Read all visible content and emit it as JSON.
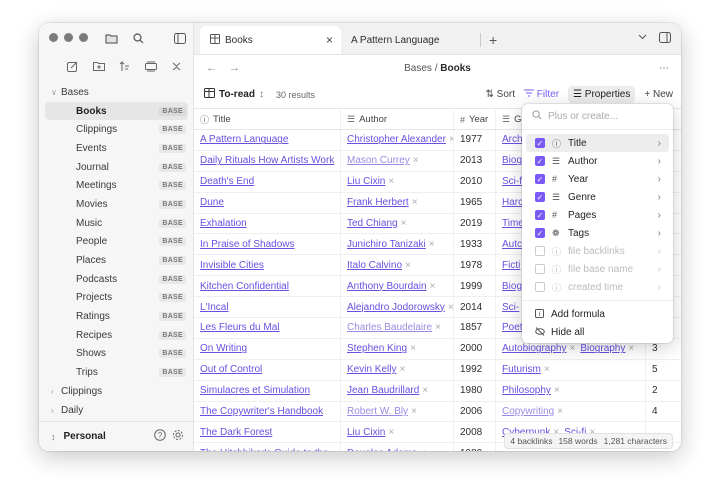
{
  "sidebar": {
    "top_icons": [
      "files-icon",
      "search-icon",
      "sidebar-toggle-icon"
    ],
    "action_icons": [
      "new-note-icon",
      "new-folder-icon",
      "sort-icon",
      "collapse-icon",
      "close-icon"
    ],
    "tree": [
      {
        "type": "folder",
        "label": "Bases",
        "open": true
      },
      {
        "type": "file",
        "label": "Books",
        "badge": "BASE",
        "active": true
      },
      {
        "type": "file",
        "label": "Clippings",
        "badge": "BASE"
      },
      {
        "type": "file",
        "label": "Events",
        "badge": "BASE"
      },
      {
        "type": "file",
        "label": "Journal",
        "badge": "BASE"
      },
      {
        "type": "file",
        "label": "Meetings",
        "badge": "BASE"
      },
      {
        "type": "file",
        "label": "Movies",
        "badge": "BASE"
      },
      {
        "type": "file",
        "label": "Music",
        "badge": "BASE"
      },
      {
        "type": "file",
        "label": "People",
        "badge": "BASE"
      },
      {
        "type": "file",
        "label": "Places",
        "badge": "BASE"
      },
      {
        "type": "file",
        "label": "Podcasts",
        "badge": "BASE"
      },
      {
        "type": "file",
        "label": "Projects",
        "badge": "BASE"
      },
      {
        "type": "file",
        "label": "Ratings",
        "badge": "BASE"
      },
      {
        "type": "file",
        "label": "Recipes",
        "badge": "BASE"
      },
      {
        "type": "file",
        "label": "Shows",
        "badge": "BASE"
      },
      {
        "type": "file",
        "label": "Trips",
        "badge": "BASE"
      },
      {
        "type": "folder",
        "label": "Clippings",
        "open": false
      },
      {
        "type": "folder",
        "label": "Daily",
        "open": false
      }
    ],
    "vault_name": "Personal"
  },
  "tabs": [
    {
      "label": "Books",
      "active": true
    },
    {
      "label": "A Pattern Language",
      "active": false
    }
  ],
  "breadcrumb": {
    "parent": "Bases",
    "sep": "/",
    "current": "Books"
  },
  "toolbar": {
    "view_name": "To-read",
    "results": "30 results",
    "sort_label": "Sort",
    "filter_label": "Filter",
    "properties_label": "Properties",
    "new_label": "New"
  },
  "table": {
    "headers": [
      "Title",
      "Author",
      "Year",
      "G"
    ],
    "rows": [
      {
        "title": "A Pattern Language",
        "author": "Christopher Alexander",
        "year": "1977",
        "genre": [
          "Arch"
        ],
        "extra": ""
      },
      {
        "title": "Daily Rituals How Artists Work",
        "author": "Mason Currey",
        "author_muted": true,
        "year": "2013",
        "genre": [
          "Biog"
        ],
        "extra": "2"
      },
      {
        "title": "Death's End",
        "author": "Liu Cixin",
        "year": "2010",
        "genre": [
          "Sci-f"
        ],
        "extra": "6"
      },
      {
        "title": "Dune",
        "author": "Frank Herbert",
        "year": "1965",
        "genre": [
          "Harc"
        ],
        "extra": ""
      },
      {
        "title": "Exhalation",
        "author": "Ted Chiang",
        "year": "2019",
        "genre": [
          "Time"
        ],
        "extra": ""
      },
      {
        "title": "In Praise of Shadows",
        "author": "Junichiro Tanizaki",
        "year": "1933",
        "genre": [
          "Autc"
        ],
        "extra": ""
      },
      {
        "title": "Invisible Cities",
        "author": "Italo Calvino",
        "year": "1978",
        "genre": [
          "Ficti"
        ],
        "extra": ""
      },
      {
        "title": "Kitchen Confidential",
        "author": "Anthony Bourdain",
        "year": "1999",
        "genre": [
          "Biog"
        ],
        "extra": "3"
      },
      {
        "title": "L'Incal",
        "author": "Alejandro Jodorowsky",
        "year": "2014",
        "genre": [
          "Sci-"
        ],
        "extra": "3"
      },
      {
        "title": "Les Fleurs du Mal",
        "author": "Charles Baudelaire",
        "author_muted": true,
        "year": "1857",
        "genre": [
          "Poet"
        ],
        "extra": ""
      },
      {
        "title": "On Writing",
        "author": "Stephen King",
        "year": "2000",
        "genre": [
          "Autobiography",
          "Biography"
        ],
        "extra": "3"
      },
      {
        "title": "Out of Control",
        "author": "Kevin Kelly",
        "year": "1992",
        "genre": [
          "Futurism"
        ],
        "extra": "5"
      },
      {
        "title": "Simulacres et Simulation",
        "author": "Jean Baudrillard",
        "year": "1980",
        "genre": [
          "Philosophy"
        ],
        "extra": "2"
      },
      {
        "title": "The Copywriter's Handbook",
        "author": "Robert W. Bly",
        "author_muted": true,
        "year": "2006",
        "genre": [
          "Copywriting"
        ],
        "genre_muted": true,
        "extra": "4"
      },
      {
        "title": "The Dark Forest",
        "author": "Liu Cixin",
        "year": "2008",
        "genre": [
          "Cyberpunk",
          "Sci-fi"
        ],
        "extra": ""
      },
      {
        "title": "The Hitchhiker's Guide to the",
        "author": "Douglas Adams",
        "year": "1980",
        "genre": [
          ""
        ],
        "extra": ""
      }
    ]
  },
  "properties_menu": {
    "search_placeholder": "Plus or create...",
    "items": [
      {
        "label": "Title",
        "checked": true,
        "icon": "info-icon",
        "enabled": true,
        "selected": true
      },
      {
        "label": "Author",
        "checked": true,
        "icon": "list-icon",
        "enabled": true
      },
      {
        "label": "Year",
        "checked": true,
        "icon": "number-icon",
        "enabled": true
      },
      {
        "label": "Genre",
        "checked": true,
        "icon": "list-icon",
        "enabled": true
      },
      {
        "label": "Pages",
        "checked": true,
        "icon": "number-icon",
        "enabled": true
      },
      {
        "label": "Tags",
        "checked": true,
        "icon": "tags-icon",
        "enabled": true
      },
      {
        "label": "file backlinks",
        "checked": false,
        "icon": "info-icon",
        "enabled": false
      },
      {
        "label": "file base name",
        "checked": false,
        "icon": "info-icon",
        "enabled": false
      },
      {
        "label": "created time",
        "checked": false,
        "icon": "info-icon",
        "enabled": false
      }
    ],
    "actions": [
      {
        "label": "Add formula",
        "icon": "formula-icon"
      },
      {
        "label": "Hide all",
        "icon": "eye-off-icon"
      }
    ]
  },
  "status_bar": {
    "backlinks": "4 backlinks",
    "words": "158 words",
    "characters": "1,281 characters"
  },
  "colors": {
    "accent": "#7a5af5",
    "link": "#6a4fe0"
  }
}
